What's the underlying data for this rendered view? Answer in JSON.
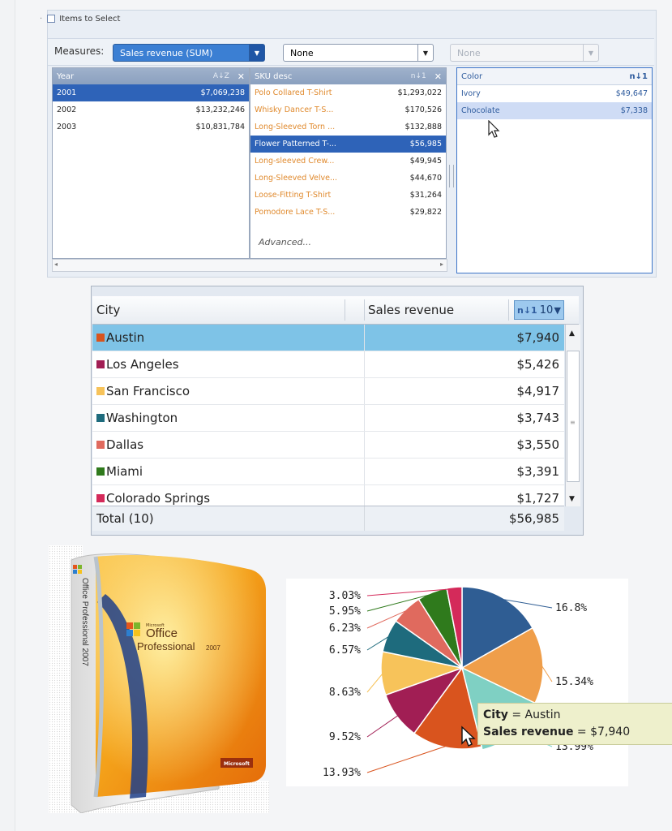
{
  "selector": {
    "header_label": "Items to Select",
    "measures_label": "Measures:",
    "measure_value": "Sales revenue (SUM)",
    "dropdown2_value": "None",
    "dropdown3_value": "None",
    "year_list": {
      "title": "Year",
      "rows": [
        {
          "label": "2001",
          "value": "$7,069,238",
          "selected": true
        },
        {
          "label": "2002",
          "value": "$13,232,246",
          "selected": false
        },
        {
          "label": "2003",
          "value": "$10,831,784",
          "selected": false
        }
      ]
    },
    "sku_list": {
      "title": "SKU desc",
      "rows": [
        {
          "label": "Polo Collared T-Shirt",
          "value": "$1,293,022",
          "selected": false
        },
        {
          "label": "Whisky Dancer T-S...",
          "value": "$170,526",
          "selected": false
        },
        {
          "label": "Long-Sleeved Torn ...",
          "value": "$132,888",
          "selected": false
        },
        {
          "label": "Flower Patterned T-...",
          "value": "$56,985",
          "selected": true
        },
        {
          "label": "Long-sleeved Crew...",
          "value": "$49,945",
          "selected": false
        },
        {
          "label": "Long-Sleeved Velve...",
          "value": "$44,670",
          "selected": false
        },
        {
          "label": "Loose-Fitting T-Shirt",
          "value": "$31,264",
          "selected": false
        },
        {
          "label": "Pomodore Lace T-S...",
          "value": "$29,822",
          "selected": false
        }
      ],
      "advanced_label": "Advanced..."
    },
    "color_list": {
      "title": "Color",
      "rows": [
        {
          "label": "Ivory",
          "value": "$49,647",
          "selected": false
        },
        {
          "label": "Chocolate",
          "value": "$7,338",
          "selected": true
        }
      ]
    }
  },
  "city_table": {
    "col_city": "City",
    "col_revenue": "Sales revenue",
    "topn": "10",
    "rows": [
      {
        "city": "Austin",
        "value": "$7,940",
        "color": "#d9541e",
        "selected": true
      },
      {
        "city": "Los Angeles",
        "value": "$5,426",
        "color": "#a11e54",
        "selected": false
      },
      {
        "city": "San Francisco",
        "value": "$4,917",
        "color": "#f7c35a",
        "selected": false
      },
      {
        "city": "Washington",
        "value": "$3,743",
        "color": "#1e6b7d",
        "selected": false
      },
      {
        "city": "Dallas",
        "value": "$3,550",
        "color": "#e06a5e",
        "selected": false
      },
      {
        "city": "Miami",
        "value": "$3,391",
        "color": "#2f7a1c",
        "selected": false
      },
      {
        "city": "Colorado Springs",
        "value": "$1,727",
        "color": "#d42a5a",
        "selected": false
      }
    ],
    "total_label": "Total (10)",
    "total_value": "$56,985"
  },
  "product_box": {
    "spine_text": "Office Professional 2007",
    "brand_small": "Microsoft",
    "brand_office": "Office",
    "brand_product": "Professional",
    "brand_year": "2007",
    "badge": "Microsoft"
  },
  "chart_data": {
    "type": "pie",
    "slices": [
      {
        "label": "16.8%",
        "value": 16.8,
        "color": "#2f5d93"
      },
      {
        "label": "15.34%",
        "value": 15.34,
        "color": "#ef9e4a"
      },
      {
        "label": "13.99%",
        "value": 13.99,
        "color": "#7fd0c3"
      },
      {
        "label": "13.93%",
        "value": 13.93,
        "color": "#d9541e"
      },
      {
        "label": "9.52%",
        "value": 9.52,
        "color": "#a11e54"
      },
      {
        "label": "8.63%",
        "value": 8.63,
        "color": "#f7c35a"
      },
      {
        "label": "6.57%",
        "value": 6.57,
        "color": "#1e6b7d"
      },
      {
        "label": "6.23%",
        "value": 6.23,
        "color": "#e06a5e"
      },
      {
        "label": "5.95%",
        "value": 5.95,
        "color": "#2f7a1c"
      },
      {
        "label": "3.03%",
        "value": 3.03,
        "color": "#d42a5a"
      }
    ]
  },
  "tooltip": {
    "city_key": "City",
    "city_value": "Austin",
    "rev_key": "Sales revenue",
    "rev_value": "$7,940"
  }
}
